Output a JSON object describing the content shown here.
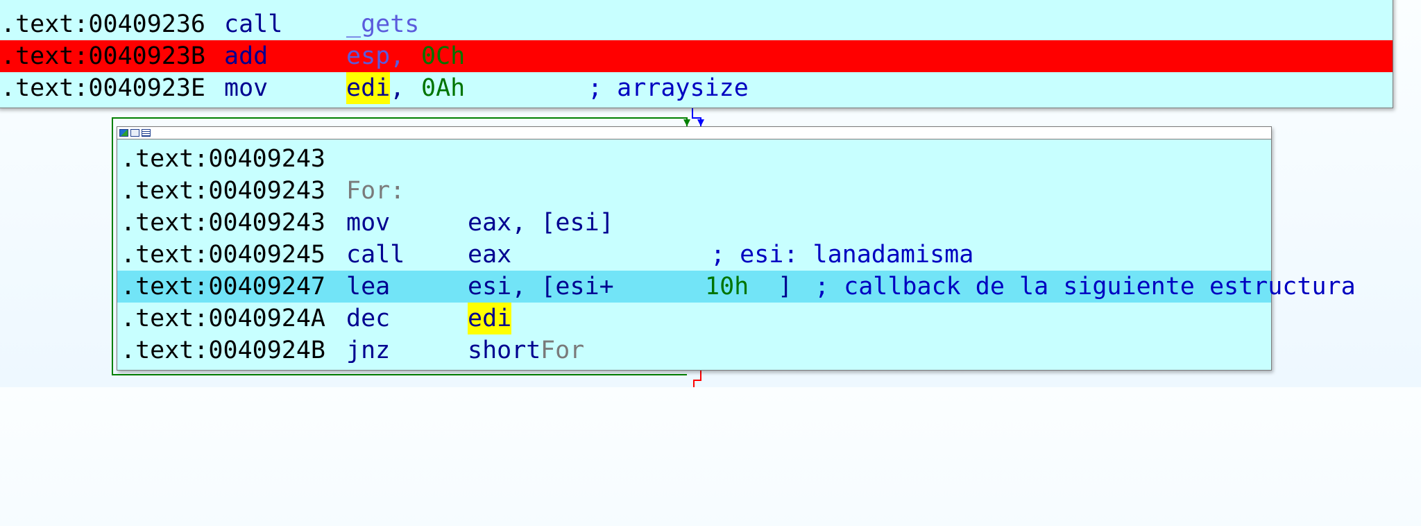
{
  "top_block": {
    "lines": [
      {
        "addr": ".text:00409236",
        "mnemonic": "call",
        "op1": "_gets"
      },
      {
        "addr": ".text:0040923B",
        "mnemonic": "add",
        "op1": "esp",
        "sep": ",",
        "op2": "0Ch"
      },
      {
        "addr": ".text:0040923E",
        "mnemonic": "mov",
        "op1": "edi",
        "sep": ",",
        "op2": "0Ah",
        "comment": "; arraysize"
      }
    ]
  },
  "loop_block": {
    "lines": [
      {
        "addr": ".text:00409243"
      },
      {
        "addr": ".text:00409243",
        "label": "For:"
      },
      {
        "addr": ".text:00409243",
        "mnemonic": "mov",
        "operands": "eax, [esi]"
      },
      {
        "addr": ".text:00409245",
        "mnemonic": "call",
        "operands": "eax",
        "comment": "; esi: lanadamisma"
      },
      {
        "addr": ".text:00409247",
        "mnemonic": "lea",
        "op_a": "esi, [esi+",
        "op_num": "10h",
        "op_b": "]",
        "comment": "; callback de la siguiente estructura"
      },
      {
        "addr": ".text:0040924A",
        "mnemonic": "dec",
        "op1": "edi"
      },
      {
        "addr": ".text:0040924B",
        "mnemonic": "jnz",
        "op_a": "short ",
        "op_label": "For"
      }
    ]
  },
  "colors": {
    "node_bg": "#c8ffff",
    "breakpoint_highlight": "#ff0000",
    "current_line_highlight": "#72e4f7",
    "register_highlight": "#ffff00",
    "true_edge": "#008000",
    "false_edge": "#0000ff",
    "exit_edge": "#ff0000"
  }
}
